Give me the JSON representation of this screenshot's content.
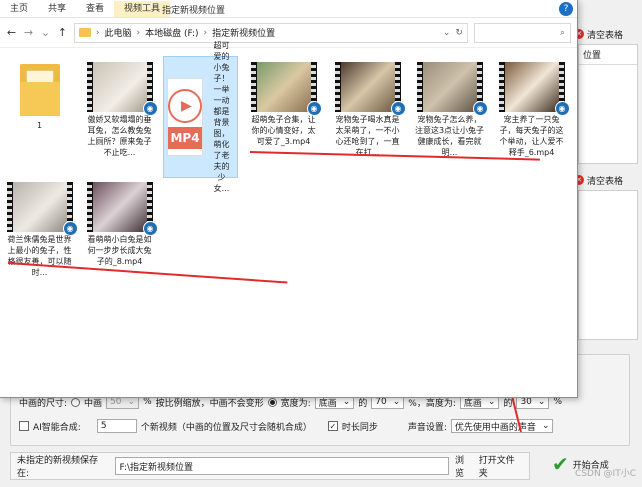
{
  "explorer": {
    "tabs": [
      "主页",
      "共享",
      "查看",
      "视频工具"
    ],
    "ribbon_title": "指定新视频位置",
    "breadcrumb": [
      "此电脑",
      "本地磁盘 (F:)",
      "指定新视频位置"
    ],
    "search_icon": "search-icon",
    "items": [
      {
        "kind": "folder",
        "caption": "1"
      },
      {
        "kind": "video",
        "caption": "傲娇又软塌塌的垂耳兔，怎么教兔兔上厕所？原来兔子不止吃..."
      },
      {
        "kind": "mp4doc",
        "caption": "超可爱的小兔子！一举一动都是背景图，萌化了老夫的少女...",
        "label": "MP4"
      },
      {
        "kind": "video",
        "caption": "超萌兔子合集，让你的心情变好，太可爱了_3.mp4"
      },
      {
        "kind": "video",
        "caption": "宠物兔子喝水真是太呆萌了，一不小心还呛到了，一直在打..."
      },
      {
        "kind": "video",
        "caption": "宠物兔子怎么养，注意这3点让小兔子健康成长，看完就明..."
      },
      {
        "kind": "video",
        "caption": "宠主养了一只兔子，每天兔子的这个举动，让人爱不释手_6.mp4"
      },
      {
        "kind": "video",
        "caption": "荷兰侏儒兔是世界上最小的兔子，性格很友善，可以随时..."
      },
      {
        "kind": "video",
        "caption": "看萌萌小白兔是如何一步步长成大兔子的_8.mp4"
      }
    ]
  },
  "bg": {
    "clear_table_1": "清空表格",
    "panel_header": "位置",
    "clear_table_2": "清空表格",
    "row1": {
      "label": "中画的尺寸:",
      "opt_a": "中画",
      "val_a": "50",
      "pct": "%",
      "note": "按比例缩放，中画不会变形",
      "opt_b": "宽度为:",
      "sel_b": "底画",
      "of": "的",
      "val_b": "70",
      "height_label": "%，高度为:",
      "sel_c": "底画",
      "of2": "的",
      "val_c": "30",
      "pct2": "%"
    },
    "row2": {
      "ai_label": "AI智能合成:",
      "count": "5",
      "count_note": "个新视频（中画的位置及尺寸会随机合成）",
      "sync_label": "时长同步",
      "audio_label": "声音设置:",
      "audio_value": "优先使用中画的声音"
    },
    "output": {
      "label": "未指定的新视频保存在:",
      "path": "F:\\指定新视频位置",
      "browse": "浏览",
      "open_folder": "打开文件夹"
    },
    "start": "开始合成",
    "watermark": "CSDN @IT小C"
  }
}
